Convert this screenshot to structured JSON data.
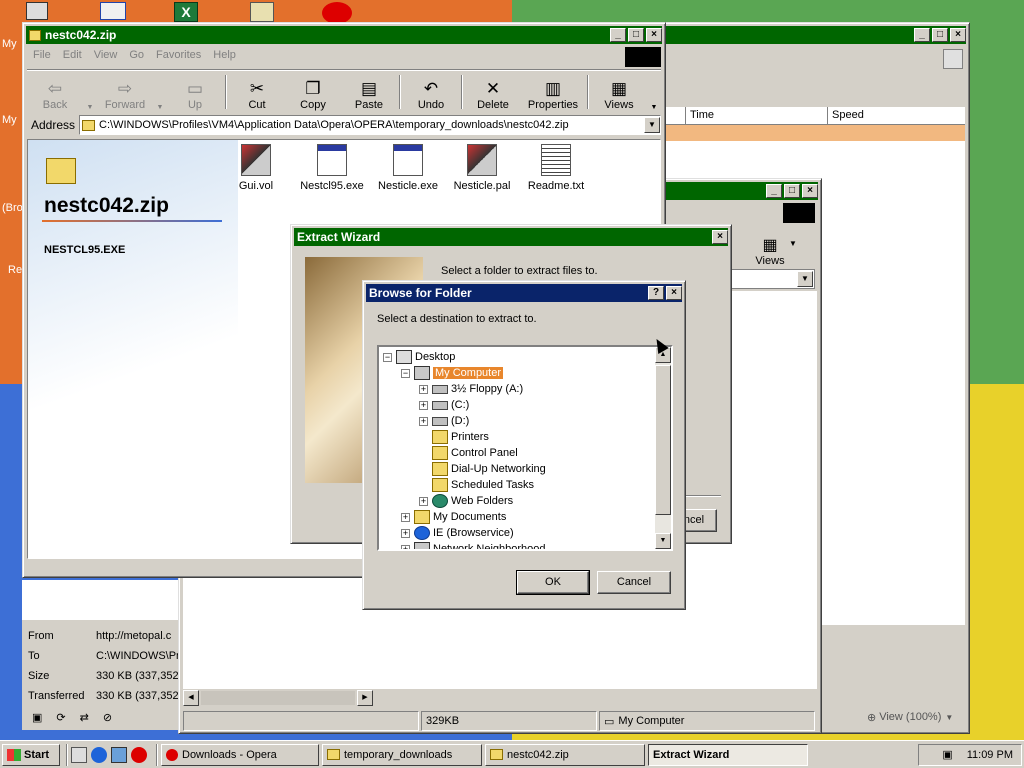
{
  "colors": {
    "active_title": "#0a246a",
    "inactive_title": "#006600",
    "window_face": "#d4d0c8"
  },
  "explorer": {
    "title": "nestc042.zip",
    "menu": [
      "File",
      "Edit",
      "View",
      "Go",
      "Favorites",
      "Help"
    ],
    "toolbar": {
      "back": "Back",
      "forward": "Forward",
      "up": "Up",
      "cut": "Cut",
      "copy": "Copy",
      "paste": "Paste",
      "undo": "Undo",
      "delete": "Delete",
      "properties": "Properties",
      "views": "Views"
    },
    "address_label": "Address",
    "address": "C:\\WINDOWS\\Profiles\\VM4\\Application Data\\Opera\\OPERA\\temporary_downloads\\nestc042.zip",
    "panel_title": "nestc042.zip",
    "panel_selected": "NESTCL95.EXE",
    "files": [
      {
        "name": "Gui.vol",
        "icon": "vol-file-icon"
      },
      {
        "name": "Nestcl95.exe",
        "icon": "exe-file-icon"
      },
      {
        "name": "Nesticle.exe",
        "icon": "exe-file-icon"
      },
      {
        "name": "Nesticle.pal",
        "icon": "pal-file-icon"
      },
      {
        "name": "Readme.txt",
        "icon": "txt-file-icon"
      }
    ]
  },
  "downloads": {
    "columns": [
      "Time",
      "Speed"
    ],
    "details": [
      {
        "label": "From",
        "value": "http://metopal.c"
      },
      {
        "label": "To",
        "value": "C:\\WINDOWS\\Pr"
      },
      {
        "label": "Size",
        "value": "330 KB (337,352"
      },
      {
        "label": "Transferred",
        "value": "330 KB (337,352"
      }
    ],
    "zoom": "View (100%)"
  },
  "second_explorer": {
    "views_label": "Views",
    "status_size": "329KB",
    "status_location": "My Computer"
  },
  "wizard": {
    "title": "Extract Wizard",
    "prompt": "Select a folder to extract files to.",
    "cancel_fragment": "ncel"
  },
  "browse": {
    "title": "Browse for Folder",
    "help": "?",
    "prompt": "Select a destination to extract to.",
    "ok": "OK",
    "cancel": "Cancel",
    "tree": [
      {
        "label": "Desktop",
        "icon": "desktop-icon",
        "expander": "−"
      },
      {
        "label": "My Computer",
        "icon": "my-computer-icon",
        "expander": "−",
        "selected": true
      },
      {
        "label": "3½ Floppy (A:)",
        "icon": "floppy-drive-icon",
        "expander": "+"
      },
      {
        "label": "(C:)",
        "icon": "hard-drive-icon",
        "expander": "+"
      },
      {
        "label": "(D:)",
        "icon": "cd-drive-icon",
        "expander": "+"
      },
      {
        "label": "Printers",
        "icon": "printers-folder-icon",
        "expander": ""
      },
      {
        "label": "Control Panel",
        "icon": "control-panel-icon",
        "expander": ""
      },
      {
        "label": "Dial-Up Networking",
        "icon": "dialup-folder-icon",
        "expander": ""
      },
      {
        "label": "Scheduled Tasks",
        "icon": "scheduled-tasks-icon",
        "expander": ""
      },
      {
        "label": "Web Folders",
        "icon": "web-folders-icon",
        "expander": "+"
      },
      {
        "label": "My Documents",
        "icon": "my-documents-icon",
        "expander": "+"
      },
      {
        "label": "IE (Browservice)",
        "icon": "ie-icon",
        "expander": "+"
      },
      {
        "label": "Network Neighborhood",
        "icon": "network-icon",
        "expander": "+"
      }
    ]
  },
  "desktop_fragments": [
    "My",
    "My",
    "(Bro",
    "Re"
  ],
  "taskbar": {
    "start": "Start",
    "tasks": [
      "Downloads - Opera",
      "temporary_downloads",
      "nestc042.zip",
      "Extract Wizard"
    ],
    "active_task": "Extract Wizard",
    "clock": "11:09 PM"
  }
}
